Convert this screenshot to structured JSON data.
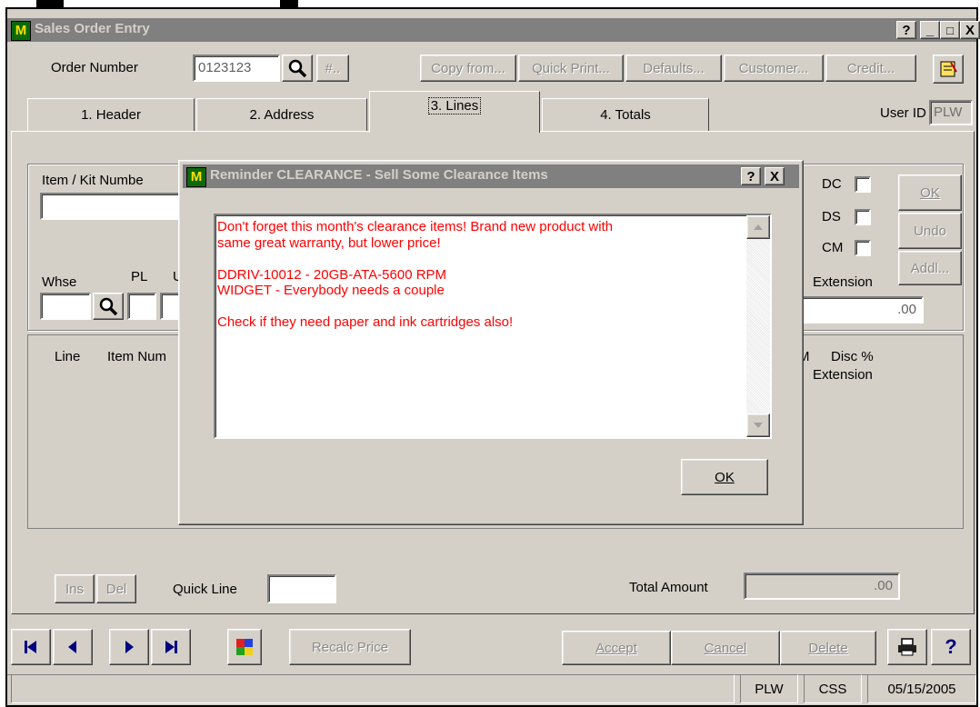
{
  "window": {
    "title": "Sales Order Entry",
    "help_btn": "?",
    "minimize_btn": "_",
    "maximize_btn": "□",
    "close_btn": "X"
  },
  "toolbar": {
    "order_number_label": "Order Number",
    "order_number_value": "0123123",
    "hash_btn": "#..",
    "copy_from": "Copy from...",
    "quick_print": "Quick Print...",
    "defaults": "Defaults...",
    "customer": "Customer...",
    "credit": "Credit..."
  },
  "tabs": [
    {
      "label": "1. Header"
    },
    {
      "label": "2. Address"
    },
    {
      "label": "3. Lines"
    },
    {
      "label": "4. Totals"
    }
  ],
  "user_id": {
    "label": "User ID",
    "value": "PLW"
  },
  "lines_panel": {
    "item_kit_label": "Item / Kit Numbe",
    "whse_label": "Whse",
    "pl_label": "PL",
    "u_label": "U",
    "dc_label": "DC",
    "ds_label": "DS",
    "cm_label": "CM",
    "ok_btn": "OK",
    "undo_btn": "Undo",
    "add_btn": "Addl...",
    "extension_label": "Extension",
    "extension_value": ".00"
  },
  "grid": {
    "headers": [
      "Line",
      "Item Num",
      "M",
      "Disc %",
      "Extension"
    ]
  },
  "bottom": {
    "ins_btn": "Ins",
    "del_btn": "Del",
    "quick_line_label": "Quick Line",
    "total_amount_label": "Total Amount",
    "total_amount_value": ".00"
  },
  "nav": {
    "recalc_price": "Recalc Price",
    "accept": "Accept",
    "cancel": "Cancel",
    "delete": "Delete",
    "help": "?"
  },
  "status_bar": {
    "user": "PLW",
    "company": "CSS",
    "date": "05/15/2005"
  },
  "dialog": {
    "title": "Reminder CLEARANCE  - Sell Some Clearance Items",
    "help_btn": "?",
    "close_btn": "X",
    "message_lines": [
      "Don't forget this month's clearance items!   Brand new product with",
      "same great warranty, but lower price!",
      "",
      "DDRIV-10012 - 20GB-ATA-5600 RPM",
      "WIDGET - Everybody needs a couple",
      "",
      "Check if they need paper and ink cartridges also!"
    ],
    "ok_btn": "OK"
  },
  "colors": {
    "face": "#d4d0c8",
    "inactive_title": "#808080",
    "message_text": "#ff0000"
  }
}
